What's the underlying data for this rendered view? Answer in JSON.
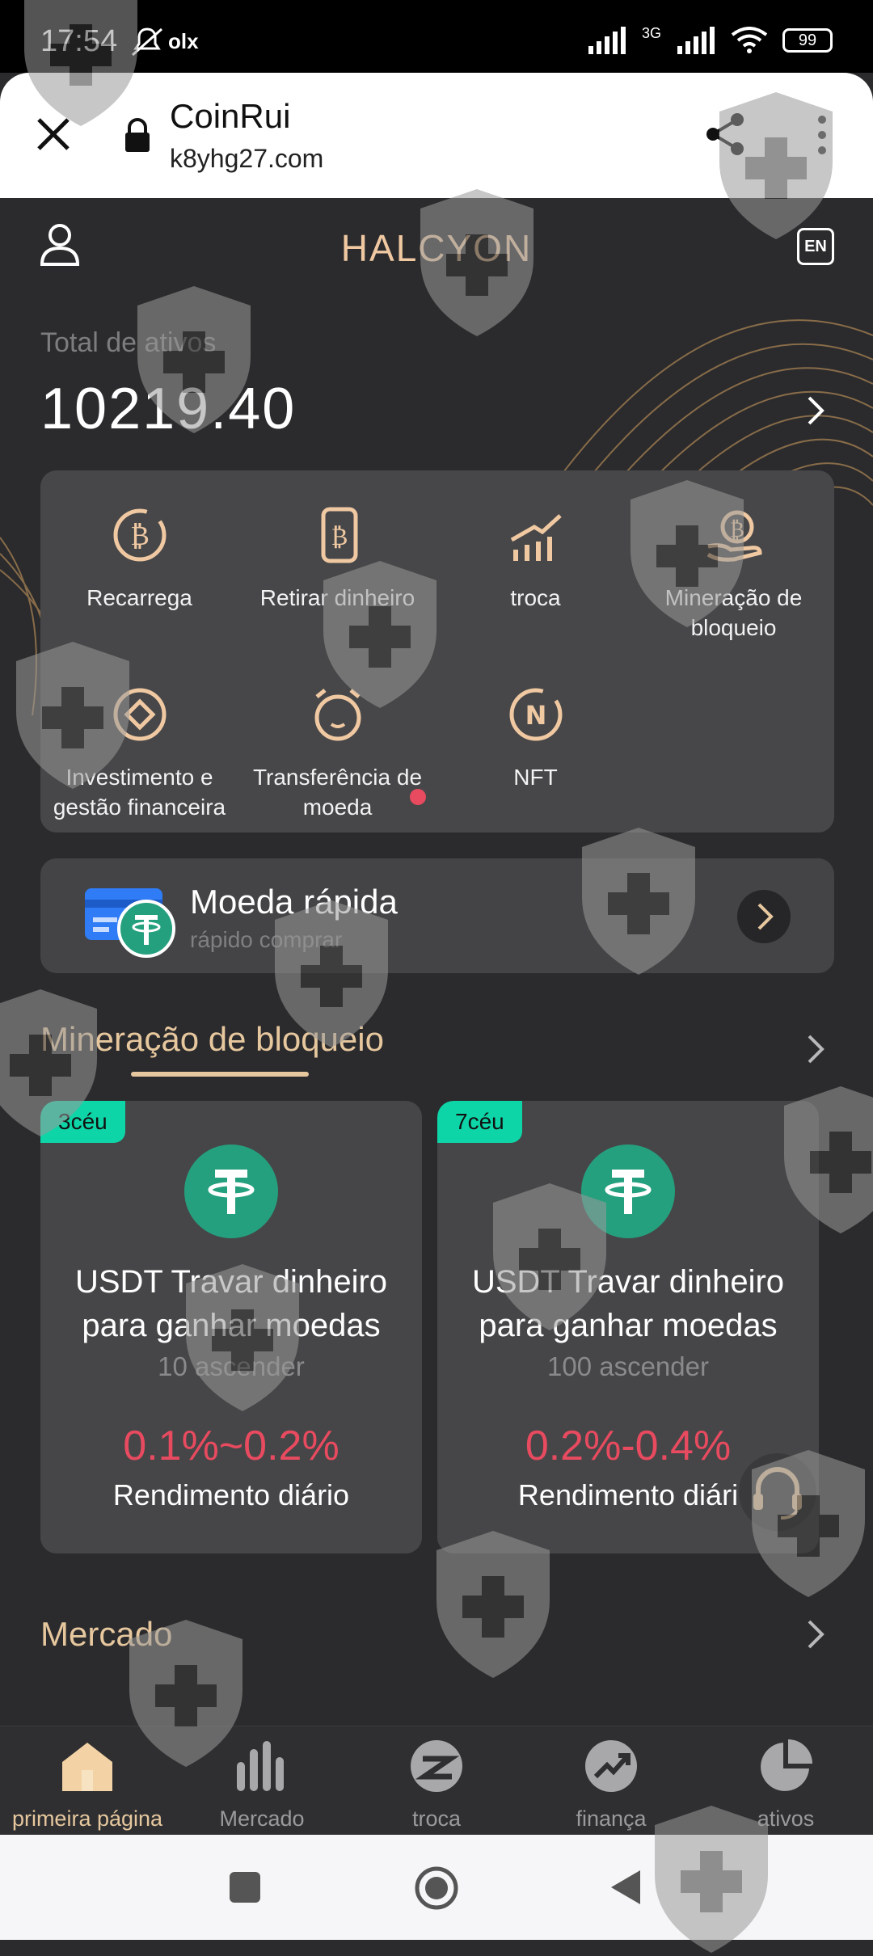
{
  "status_bar": {
    "time": "17:54",
    "carrier_icon": "olx",
    "network": "3G",
    "battery": "99"
  },
  "browser": {
    "site_name": "CoinRui",
    "url": "k8yhg27.com"
  },
  "header": {
    "title": "HALCYON",
    "language": "EN"
  },
  "assets": {
    "label": "Total de ativos",
    "value": "10219.40"
  },
  "menu": [
    {
      "label": "Recarrega",
      "icon": "bitcoin-cycle-icon"
    },
    {
      "label": "Retirar dinheiro",
      "icon": "bitcoin-wallet-icon"
    },
    {
      "label": "troca",
      "icon": "trend-chart-icon"
    },
    {
      "label": "Mineração de bloqueio",
      "icon": "bitcoin-hand-icon"
    },
    {
      "label": "Investimento e gestão financeira",
      "icon": "diamond-circle-icon"
    },
    {
      "label": "Transferência de moeda",
      "icon": "alarm-clock-icon"
    },
    {
      "label": "NFT",
      "icon": "nft-icon"
    }
  ],
  "quick_coin": {
    "title": "Moeda rápida",
    "subtitle": "rápido comprar"
  },
  "mining": {
    "title": "Mineração de bloqueio",
    "cards": [
      {
        "badge": "3céu",
        "title_line1": "USDT Travar dinheiro",
        "title_line2": "para ganhar moedas",
        "min": "10 ascender",
        "rate": "0.1%~0.2%",
        "rate_label": "Rendimento diário"
      },
      {
        "badge": "7céu",
        "title_line1": "USDT Travar dinheiro",
        "title_line2": "para ganhar moedas",
        "min": "100 ascender",
        "rate": "0.2%-0.4%",
        "rate_label": "Rendimento diári"
      }
    ]
  },
  "market": {
    "title": "Mercado"
  },
  "nav": [
    {
      "label": "primeira página",
      "active": true
    },
    {
      "label": "Mercado"
    },
    {
      "label": "troca"
    },
    {
      "label": "finança"
    },
    {
      "label": "ativos"
    }
  ],
  "colors": {
    "accent": "#f0c9a2",
    "gold": "#e6c79e",
    "teal": "#0ed5a8",
    "red": "#e84a5f",
    "usdt": "#25a07e"
  }
}
